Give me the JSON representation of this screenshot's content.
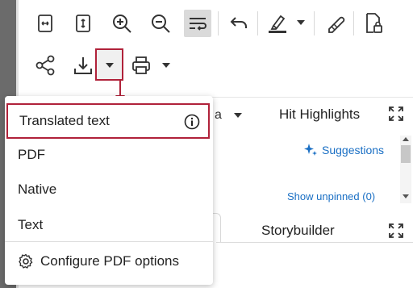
{
  "toolbar": {
    "icons": [
      "fit-width-icon",
      "fit-height-icon",
      "zoom-in-icon",
      "zoom-out-icon",
      "wrap-text-icon",
      "undo-icon",
      "highlighter-icon",
      "pen-icon",
      "document-lock-icon",
      "share-icon",
      "download-icon",
      "print-icon"
    ]
  },
  "panel": {
    "tab_partial": "a",
    "hit_highlights": "Hit Highlights",
    "suggestions": "Suggestions",
    "show_unpinned": "Show unpinned (0)",
    "storybuilder": "Storybuilder"
  },
  "download_menu": {
    "items": [
      {
        "label": "Translated text",
        "highlighted": true
      },
      {
        "label": "PDF"
      },
      {
        "label": "Native"
      },
      {
        "label": "Text"
      }
    ],
    "configure": "Configure PDF options"
  },
  "colors": {
    "callout": "#b0223a",
    "link": "#1a6fc4",
    "left_bar": "#6b6b6b"
  }
}
